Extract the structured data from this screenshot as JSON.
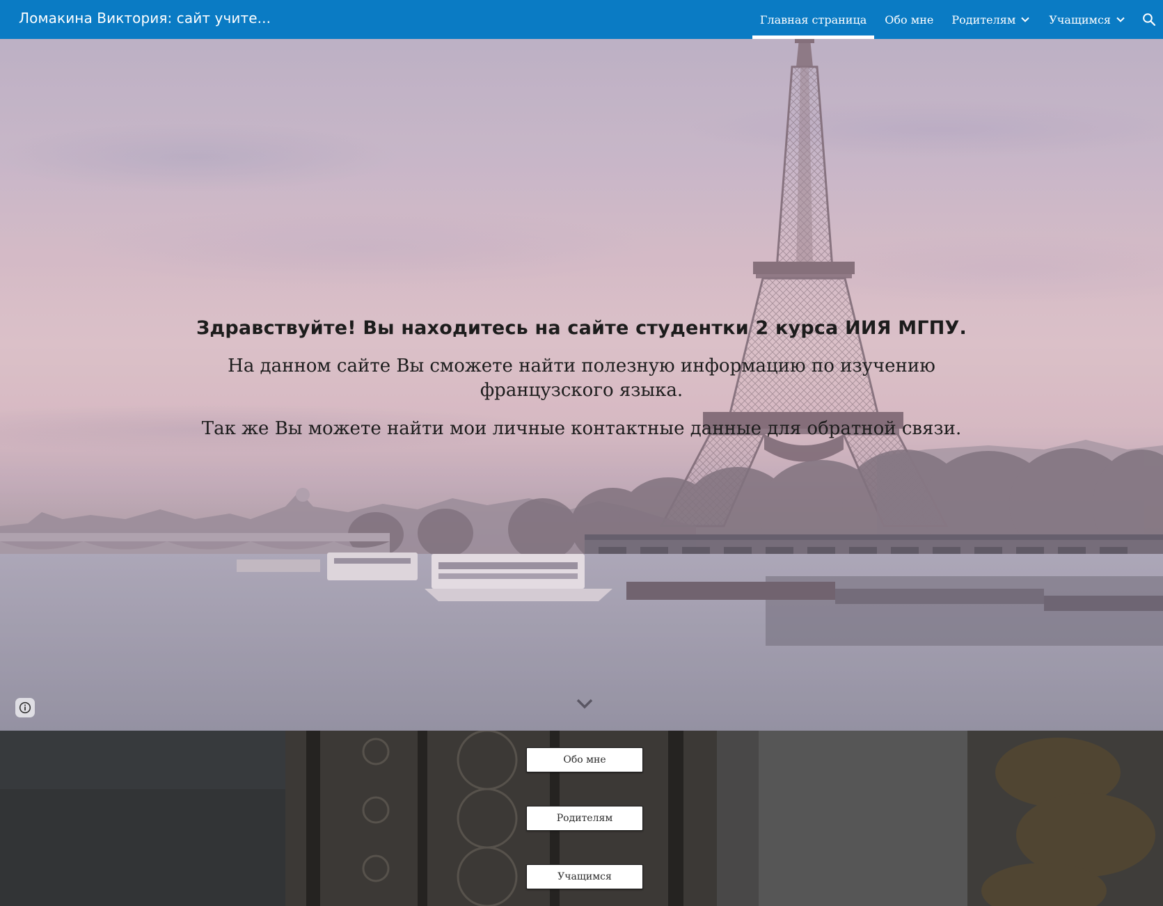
{
  "header": {
    "site_title": "Ломакина Виктория: сайт учите...",
    "nav": [
      {
        "label": "Главная страница",
        "active": true,
        "has_dropdown": false
      },
      {
        "label": "Обо мне",
        "active": false,
        "has_dropdown": false
      },
      {
        "label": "Родителям",
        "active": false,
        "has_dropdown": true
      },
      {
        "label": "Учащимся",
        "active": false,
        "has_dropdown": true
      }
    ],
    "search_icon": "search-icon",
    "background_color": "#0a7bc4"
  },
  "hero": {
    "heading": "Здравствуйте! Вы находитесь на сайте студентки 2 курса ИИЯ МГПУ.",
    "paragraph_1": "На данном сайте Вы сможете найти полезную информацию по изучению французского языка.",
    "paragraph_2": "Так же Вы можете найти мои личные контактные данные для обратной связи.",
    "info_icon": "info-icon",
    "scroll_icon": "chevron-down-icon"
  },
  "buttons": [
    {
      "label": "Обо мне"
    },
    {
      "label": "Родителям"
    },
    {
      "label": "Учащимся"
    }
  ]
}
